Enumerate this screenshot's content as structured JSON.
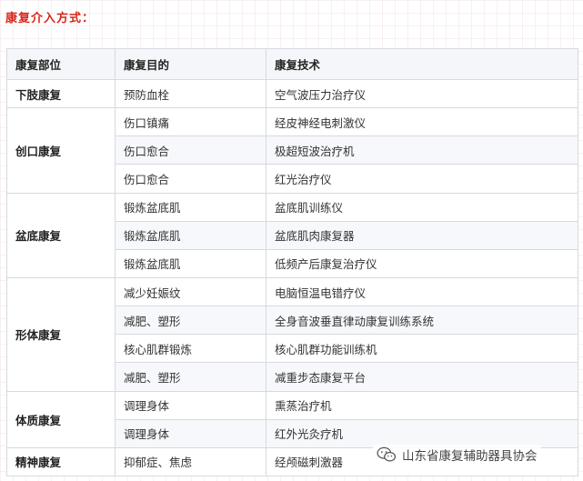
{
  "heading": "康复介入方式：",
  "table": {
    "headers": [
      "康复部位",
      "康复目的",
      "康复技术"
    ],
    "groups": [
      {
        "part": "下肢康复",
        "rows": [
          {
            "goal": "预防血栓",
            "tech": "空气波压力治疗仪"
          }
        ]
      },
      {
        "part": "创口康复",
        "rows": [
          {
            "goal": "伤口镇痛",
            "tech": "经皮神经电刺激仪"
          },
          {
            "goal": "伤口愈合",
            "tech": "极超短波治疗机"
          },
          {
            "goal": "伤口愈合",
            "tech": "红光治疗仪"
          }
        ]
      },
      {
        "part": "盆底康复",
        "rows": [
          {
            "goal": "锻炼盆底肌",
            "tech": "盆底肌训练仪"
          },
          {
            "goal": "锻炼盆底肌",
            "tech": "盆底肌肉康复器"
          },
          {
            "goal": "锻炼盆底肌",
            "tech": "低频产后康复治疗仪"
          }
        ]
      },
      {
        "part": "形体康复",
        "rows": [
          {
            "goal": "减少妊娠纹",
            "tech": "电脑恒温电错疗仪"
          },
          {
            "goal": "减肥、塑形",
            "tech": "全身音波垂直律动康复训练系统"
          },
          {
            "goal": "核心肌群锻炼",
            "tech": "核心肌群功能训练机"
          },
          {
            "goal": "减肥、塑形",
            "tech": "减重步态康复平台"
          }
        ]
      },
      {
        "part": "体质康复",
        "rows": [
          {
            "goal": "调理身体",
            "tech": "熏蒸治疗机"
          },
          {
            "goal": "调理身体",
            "tech": "红外光灸疗机"
          }
        ]
      },
      {
        "part": "精神康复",
        "rows": [
          {
            "goal": "抑郁症、焦虑",
            "tech": "经颅磁刺激器"
          }
        ]
      }
    ]
  },
  "watermark": {
    "text": "山东省康复辅助器具协会",
    "icon": "wechat-icon"
  }
}
